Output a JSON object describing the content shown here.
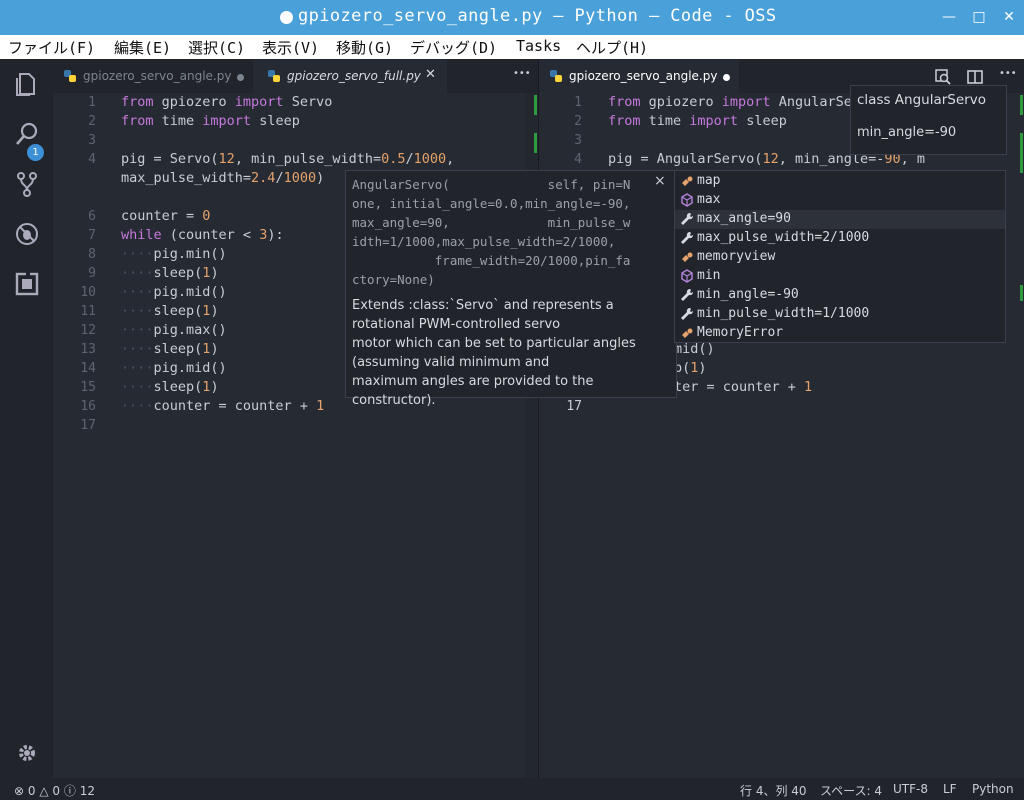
{
  "window": {
    "title": "gpiozero_servo_angle.py — Python — Code - OSS"
  },
  "menu": [
    "ファイル(F)",
    "編集(E)",
    "選択(C)",
    "表示(V)",
    "移動(G)",
    "デバッグ(D)",
    "Tasks",
    "ヘルプ(H)"
  ],
  "activity": {
    "badge": "1"
  },
  "left_tabs": [
    {
      "label": "gpiozero_servo_angle.py"
    },
    {
      "label": "gpiozero_servo_full.py"
    }
  ],
  "left_more": "•••",
  "right_tab": {
    "label": "gpiozero_servo_angle.py"
  },
  "right_more": "•••",
  "left_lines": {
    "numbers": [
      "1",
      "2",
      "3",
      "4",
      "",
      "5",
      "6",
      "7",
      "8",
      "9",
      "10",
      "11",
      "12",
      "13",
      "14",
      "15",
      "16",
      "17"
    ],
    "l1": [
      "from",
      " gpiozero ",
      "import",
      " Servo"
    ],
    "l2": [
      "from",
      " time ",
      "import",
      " sleep"
    ],
    "l4": [
      "pig = Servo(",
      "12",
      ", min_pulse_width=",
      "0.5",
      "/",
      "1000",
      ","
    ],
    "l4b": [
      "max_pulse_width=",
      "2.4",
      "/",
      "1000",
      ")"
    ],
    "l6": [
      "counter = ",
      "0"
    ],
    "l7": [
      "while",
      " (counter < ",
      "3",
      "):"
    ],
    "l8": "pig.min()",
    "l9": [
      "sleep(",
      "1",
      ")"
    ],
    "l10": "pig.mid()",
    "l11": [
      "sleep(",
      "1",
      ")"
    ],
    "l12": "pig.max()",
    "l13": [
      "sleep(",
      "1",
      ")"
    ],
    "l14": "pig.mid()",
    "l15": [
      "sleep(",
      "1",
      ")"
    ],
    "l16": [
      "counter = counter + ",
      "1"
    ]
  },
  "right_lines": {
    "numbers": [
      "1",
      "2",
      "3",
      "4",
      "17"
    ],
    "l1": [
      "from",
      " gpiozero ",
      "import",
      " AngularSe"
    ],
    "l2": [
      "from",
      " time ",
      "import",
      " sleep"
    ],
    "l4": [
      "pig = AngularServo(",
      "12",
      ", min_angle=-",
      "90",
      ", m"
    ],
    "l15a": "mid()",
    "l15b": [
      "p(",
      "1",
      ")"
    ],
    "l16": [
      "ter = counter + ",
      "1"
    ]
  },
  "signature_popup": {
    "code": "AngularServo(             self, pin=N\none, initial_angle=0.0,min_angle=-90,\nmax_angle=90,             min_pulse_w\nidth=1/1000,max_pulse_width=2/1000,\n           frame_width=20/1000,pin_fa\nctory=None)",
    "close": "×",
    "doc": "Extends :class:`Servo` and represents a rotational PWM-controlled servo\nmotor which can be set to particular angles (assuming valid minimum and\nmaximum angles are provided to the constructor)."
  },
  "autocomplete": [
    {
      "label": "map",
      "icon": "class-icon"
    },
    {
      "label": "max",
      "icon": "cube-icon"
    },
    {
      "label": "max_angle=90",
      "icon": "wrench-icon"
    },
    {
      "label": "max_pulse_width=2/1000",
      "icon": "wrench-icon"
    },
    {
      "label": "memoryview",
      "icon": "class-icon"
    },
    {
      "label": "min",
      "icon": "cube-icon"
    },
    {
      "label": "min_angle=-90",
      "icon": "wrench-icon"
    },
    {
      "label": "min_pulse_width=1/1000",
      "icon": "wrench-icon"
    },
    {
      "label": "MemoryError",
      "icon": "class-icon"
    }
  ],
  "hover_detail": {
    "title": "class AngularServo",
    "detail": "min_angle=-90"
  },
  "status": {
    "errors": "0",
    "warnings": "0",
    "infos": "12",
    "position": "行 4、列 40",
    "spaces": "スペース: 4",
    "encoding": "UTF-8",
    "eol": "LF",
    "language": "Python"
  },
  "colors": {
    "title_bar": "#4aa0d8",
    "keyword": "#c678dd",
    "number": "#e5a26b",
    "editor_bg": "#262b33"
  }
}
